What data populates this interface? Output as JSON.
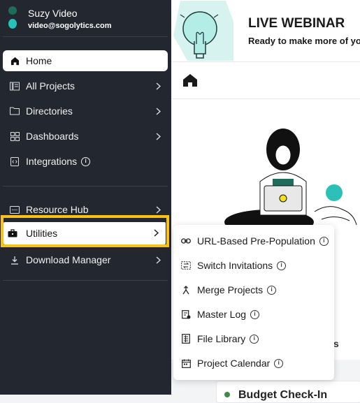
{
  "profile": {
    "name": "Suzy Video",
    "email": "video@sogolytics.com"
  },
  "nav": {
    "home": "Home",
    "all_projects": "All Projects",
    "directories": "Directories",
    "dashboards": "Dashboards",
    "integrations": "Integrations",
    "resource_hub": "Resource Hub",
    "utilities": "Utilities",
    "download_manager": "Download Manager"
  },
  "banner": {
    "title": "LIVE WEBINAR",
    "subtitle": "Ready to make more of yo"
  },
  "submenu": [
    {
      "label": "URL-Based Pre-Population",
      "icon": "link-icon"
    },
    {
      "label": "Switch Invitations",
      "icon": "switch-icon"
    },
    {
      "label": "Merge Projects",
      "icon": "merge-icon"
    },
    {
      "label": "Master Log",
      "icon": "log-icon"
    },
    {
      "label": "File Library",
      "icon": "file-library-icon"
    },
    {
      "label": "Project Calendar",
      "icon": "calendar-icon"
    }
  ],
  "partial_text": "s",
  "bottom_card_title": "Budget Check-In",
  "colors": {
    "sidebar": "#23272f",
    "highlight": "#f9c21a",
    "accent": "#27c3b8"
  }
}
